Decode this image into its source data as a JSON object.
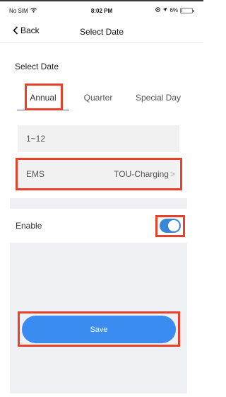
{
  "status_bar": {
    "carrier": "No SIM",
    "time": "8:02 PM",
    "battery": "6%"
  },
  "nav": {
    "back_label": "Back",
    "title": "Select Date"
  },
  "section": {
    "title": "Select Date"
  },
  "tabs": [
    {
      "label": "Annual",
      "selected": true
    },
    {
      "label": "Quarter",
      "selected": false
    },
    {
      "label": "Special Day",
      "selected": false
    }
  ],
  "range_field": {
    "value": "1~12"
  },
  "ems_field": {
    "label": "EMS",
    "value": "TOU-Charging",
    "chevron": ">"
  },
  "enable": {
    "label": "Enable",
    "on": true
  },
  "save_button": {
    "label": "Save"
  },
  "colors": {
    "accent": "#3b8cf0",
    "toggle_on": "#3a86d6",
    "highlight": "#e8402a",
    "field_bg": "#f1f1f1",
    "region_bg": "#eef0f3"
  }
}
